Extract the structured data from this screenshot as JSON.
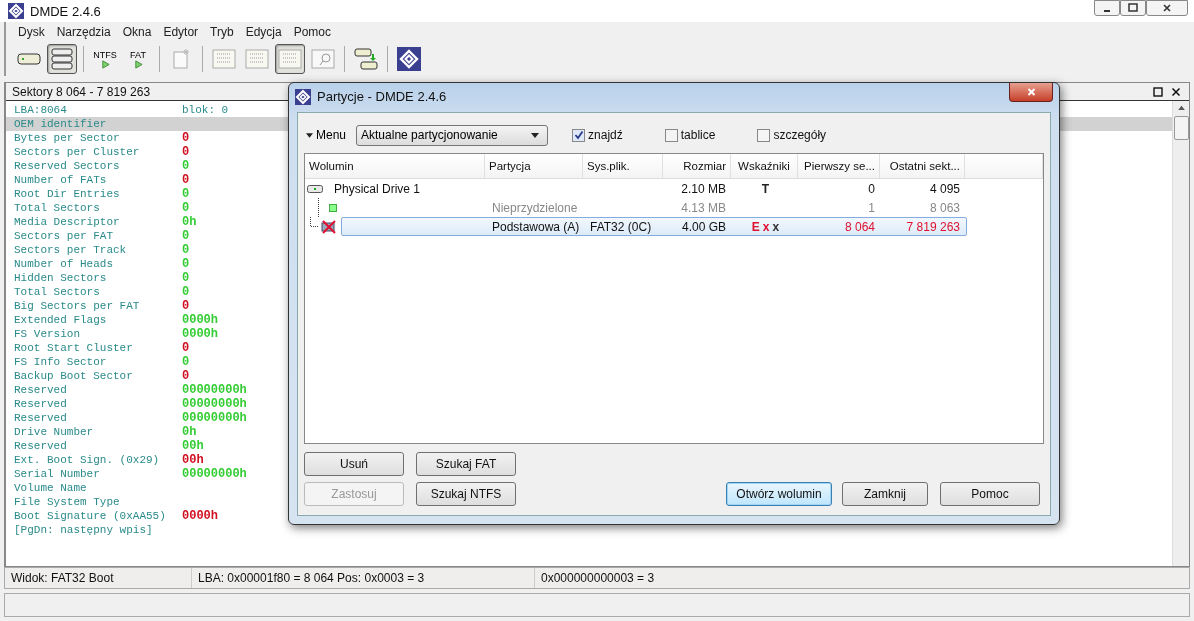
{
  "window": {
    "title": "DMDE 2.4.6"
  },
  "menu": [
    "Dysk",
    "Narzędzia",
    "Okna",
    "Edytor",
    "Tryb",
    "Edycja",
    "Pomoc"
  ],
  "toolbar": [
    {
      "kind": "disk",
      "pressed": false
    },
    {
      "kind": "list",
      "pressed": true
    },
    {
      "kind": "sep"
    },
    {
      "kind": "ntfs",
      "label": "NTFS",
      "pressed": false
    },
    {
      "kind": "fat",
      "label": "FAT",
      "pressed": false
    },
    {
      "kind": "sep"
    },
    {
      "kind": "new",
      "pressed": false
    },
    {
      "kind": "sep"
    },
    {
      "kind": "tree",
      "pressed": false
    },
    {
      "kind": "grid",
      "pressed": false
    },
    {
      "kind": "grid",
      "pressed": true
    },
    {
      "kind": "find",
      "pressed": false
    },
    {
      "kind": "sep"
    },
    {
      "kind": "copy",
      "pressed": false
    },
    {
      "kind": "sep"
    },
    {
      "kind": "logo",
      "pressed": false
    }
  ],
  "panel": {
    "title": "Sektory 8 064 - 7 819 263",
    "header_left": "LBA:8064",
    "header_right": "blok: 0",
    "highlight": "OEM identifier",
    "fields": [
      {
        "name": "Bytes per Sector",
        "value": "0",
        "color": "#d01020"
      },
      {
        "name": "Sectors per Cluster",
        "value": "0",
        "color": "#d01020"
      },
      {
        "name": "Reserved Sectors",
        "value": "0",
        "color": "#33cc33"
      },
      {
        "name": "Number of FATs",
        "value": "0",
        "color": "#d01020"
      },
      {
        "name": "Root Dir Entries",
        "value": "0",
        "color": "#33cc33"
      },
      {
        "name": "Total Sectors",
        "value": "0",
        "color": "#33cc33"
      },
      {
        "name": "Media Descriptor",
        "value": "0h",
        "color": "#33cc33"
      },
      {
        "name": "Sectors per FAT",
        "value": "0",
        "color": "#33cc33"
      },
      {
        "name": "Sectors per Track",
        "value": "0",
        "color": "#33cc33"
      },
      {
        "name": "Number of Heads",
        "value": "0",
        "color": "#33cc33"
      },
      {
        "name": "Hidden Sectors",
        "value": "0",
        "color": "#33cc33"
      },
      {
        "name": "Total Sectors",
        "value": "0",
        "color": "#33cc33"
      },
      {
        "name": "Big Sectors per FAT",
        "value": "0",
        "color": "#d01020"
      },
      {
        "name": "Extended Flags",
        "value": "0000h",
        "color": "#33cc33"
      },
      {
        "name": "FS Version",
        "value": "0000h",
        "color": "#33cc33"
      },
      {
        "name": "Root Start Cluster",
        "value": "0",
        "color": "#d01020"
      },
      {
        "name": "FS Info Sector",
        "value": "0",
        "color": "#33cc33"
      },
      {
        "name": "Backup Boot Sector",
        "value": "0",
        "color": "#d01020"
      },
      {
        "name": "Reserved",
        "value": "00000000h",
        "color": "#33cc33"
      },
      {
        "name": "Reserved",
        "value": "00000000h",
        "color": "#33cc33"
      },
      {
        "name": "Reserved",
        "value": "00000000h",
        "color": "#33cc33"
      },
      {
        "name": "Drive Number",
        "value": "0h",
        "color": "#33cc33"
      },
      {
        "name": "Reserved",
        "value": "00h",
        "color": "#33cc33"
      },
      {
        "name": "Ext. Boot Sign. (0x29)",
        "value": "00h",
        "color": "#d01020"
      },
      {
        "name": "Serial Number",
        "value": "00000000h",
        "color": "#33cc33"
      },
      {
        "name": "Volume Name"
      },
      {
        "name": "File System Type"
      },
      {
        "name": "Boot Signature (0xAA55)",
        "value": "0000h",
        "color": "#d01020"
      }
    ],
    "footer": "[PgDn: następny wpis]"
  },
  "status_bar": [
    "Widok: FAT32 Boot",
    "LBA: 0x00001f80 = 8 064  Pos: 0x0003 = 3",
    "0x000000000003 = 3"
  ],
  "dialog": {
    "title": "Partycje - DMDE 2.4.6",
    "menu": "Menu",
    "dropdown": "Aktualne partycjonowanie",
    "checkboxes": [
      {
        "label": "znajdź",
        "checked": true
      },
      {
        "label": "tablice",
        "checked": false
      },
      {
        "label": "szczegóły",
        "checked": false
      }
    ],
    "columns": [
      "Wolumin",
      "Partycja",
      "Sys.plik.",
      "Rozmiar",
      "Wskaźniki",
      "Pierwszy se...",
      "Ostatni sekt..."
    ],
    "rows": [
      {
        "kind": "drive",
        "volume": "Physical Drive 1",
        "size": "2.10 MB",
        "flags": [
          {
            "text": "T",
            "color": "#222222"
          }
        ],
        "first": "0",
        "last": "4 095",
        "selected": false,
        "invalid": false,
        "children": [
          {
            "kind": "free",
            "partition": "Nieprzydzielone",
            "size": "4.13 MB",
            "first": "1",
            "last": "8 063",
            "selected": false,
            "invalid": false
          },
          {
            "kind": "partition",
            "partition": "Podstawowa (A)",
            "fs": "FAT32 (0C)",
            "size": "4.00 GB",
            "flags": [
              {
                "text": "E",
                "color": "#e0102f"
              },
              {
                "text": "x",
                "color": "#e0102f"
              },
              {
                "text": "x",
                "color": "#333333"
              }
            ],
            "first": "8 064",
            "last": "7 819 263",
            "selected": true,
            "invalid": true
          }
        ]
      }
    ],
    "buttons": [
      {
        "label": "Usuń",
        "disabled": false,
        "default": false
      },
      {
        "label": "Szukaj FAT",
        "disabled": false,
        "default": false
      },
      {
        "label": "Zastosuj",
        "disabled": true,
        "default": false
      },
      {
        "label": "Szukaj NTFS",
        "disabled": false,
        "default": false
      },
      {
        "label": "Otwórz wolumin",
        "disabled": false,
        "default": true
      },
      {
        "label": "Zamknij",
        "disabled": false,
        "default": false
      },
      {
        "label": "Pomoc",
        "disabled": false,
        "default": false
      }
    ]
  }
}
